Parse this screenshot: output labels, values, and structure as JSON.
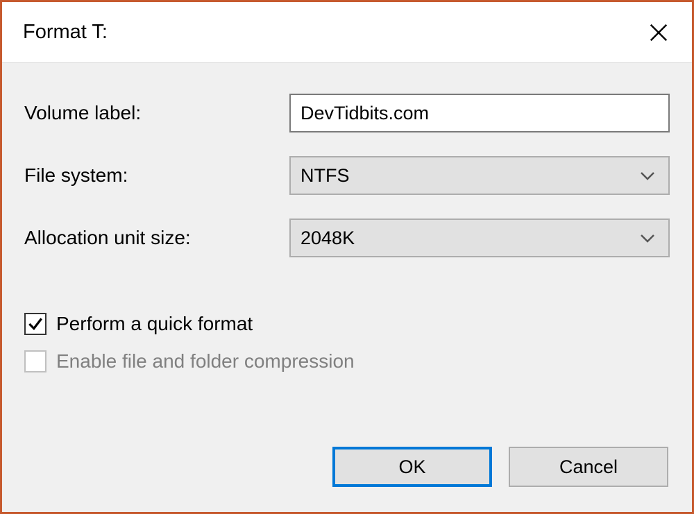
{
  "title": "Format T:",
  "labels": {
    "volume_label": "Volume label:",
    "file_system": "File system:",
    "allocation_unit_size": "Allocation unit size:"
  },
  "fields": {
    "volume_label_value": "DevTidbits.com",
    "file_system_value": "NTFS",
    "allocation_unit_size_value": "2048K"
  },
  "checkboxes": {
    "quick_format": {
      "label": "Perform a quick format",
      "checked": true,
      "enabled": true
    },
    "compression": {
      "label": "Enable file and folder compression",
      "checked": false,
      "enabled": false
    }
  },
  "buttons": {
    "ok": "OK",
    "cancel": "Cancel"
  }
}
